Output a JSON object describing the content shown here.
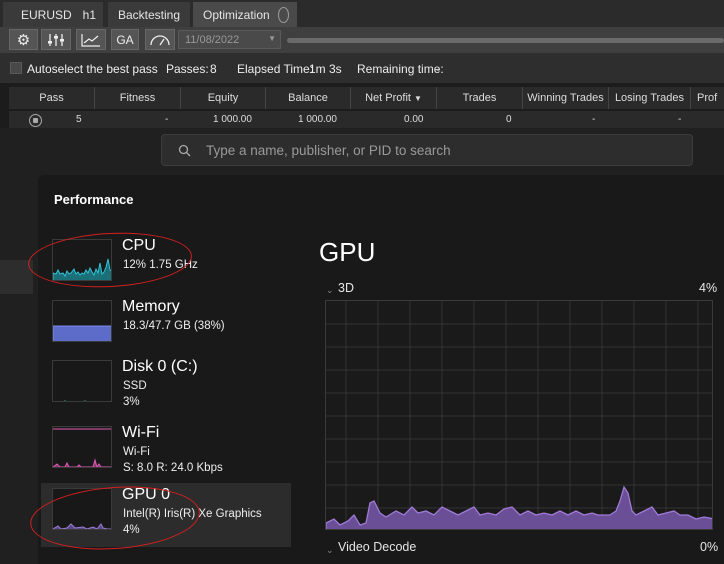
{
  "app": {
    "tabs": [
      {
        "label": "EURUSD",
        "sub": "h1"
      },
      {
        "label": "Backtesting"
      },
      {
        "label": "Optimization"
      }
    ],
    "toolbar": {
      "ga_label": "GA",
      "date": "11/08/2022"
    },
    "status": {
      "autoselect_label": "Autoselect the best pass",
      "passes_label": "Passes:",
      "passes_value": "8",
      "elapsed_label": "Elapsed Time:",
      "elapsed_value": "1m 3s",
      "remaining_label": "Remaining time:",
      "remaining_value": "-"
    },
    "columns": [
      "Pass",
      "Fitness",
      "Equity",
      "Balance",
      "Net Profit",
      "Trades",
      "Winning Trades",
      "Losing Trades",
      "Prof"
    ],
    "sort_indicator": "▼",
    "row": {
      "pass": "5",
      "fitness": "-",
      "equity": "1 000.00",
      "balance": "1 000.00",
      "net_profit": "0.00",
      "trades": "0",
      "winning": "-",
      "losing": "-"
    }
  },
  "taskmanager": {
    "search_placeholder": "Type a name, publisher, or PID to search",
    "panel_title": "Performance",
    "items": [
      {
        "name": "CPU",
        "line1": "12%  1.75 GHz",
        "line2": "",
        "color": "#2ec4d6"
      },
      {
        "name": "Memory",
        "line1": "18.3/47.7 GB (38%)",
        "line2": "",
        "color": "#6a7bd8",
        "level": 0.38
      },
      {
        "name": "Disk 0 (C:)",
        "line1": "SSD",
        "line2": "3%",
        "color": "#3fb59a"
      },
      {
        "name": "Wi-Fi",
        "line1": "Wi-Fi",
        "line2": "S: 8.0  R: 24.0 Kbps",
        "color": "#e05ab5"
      },
      {
        "name": "GPU 0",
        "line1": "Intel(R) Iris(R) Xe Graphics",
        "line2": "4%",
        "color": "#9f7ad6"
      }
    ],
    "detail": {
      "title": "GPU",
      "chart1_label": "3D",
      "chart1_value": "4%",
      "chart2_label": "Video Decode",
      "chart2_value": "0%",
      "color": "#9f7ad6"
    }
  }
}
